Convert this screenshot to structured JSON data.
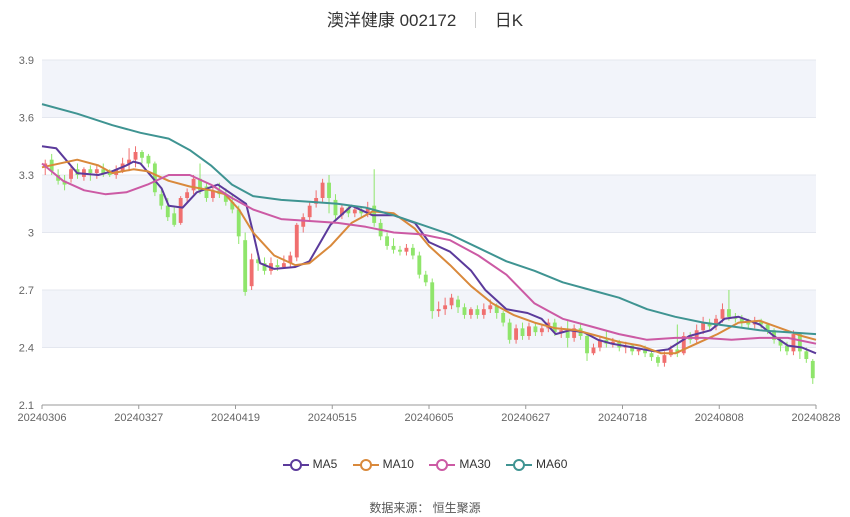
{
  "header": {
    "title": "澳洋健康 002172",
    "period": "日K"
  },
  "source": "数据来源： 恒生聚源",
  "colors": {
    "up": "#f06f6f",
    "down": "#8fe56b",
    "MA5": "#5b3a9b",
    "MA10": "#d9893b",
    "MA30": "#cc5aa4",
    "MA60": "#3f9492",
    "band": "#f2f4fa",
    "grid": "#e4e7ef"
  },
  "chart_data": {
    "type": "candlestick",
    "x_tick_labels": [
      "20240306",
      "20240327",
      "20240419",
      "20240515",
      "20240605",
      "20240627",
      "20240718",
      "20240808",
      "20240828"
    ],
    "y_ticks": [
      2.1,
      2.4,
      2.7,
      3,
      3.3,
      3.6,
      3.9
    ],
    "y_tick_labels": [
      "2.1",
      "2.4",
      "2.7",
      "3",
      "3.3",
      "3.6",
      "3.9"
    ],
    "ylim": [
      2.1,
      3.9
    ],
    "grid": true,
    "legend_position": "bottom",
    "legend": [
      "MA5",
      "MA10",
      "MA30",
      "MA60"
    ],
    "ohlc": [
      [
        3.34,
        3.36,
        3.3,
        3.38
      ],
      [
        3.38,
        3.32,
        3.3,
        3.41
      ],
      [
        3.3,
        3.27,
        3.25,
        3.33
      ],
      [
        3.27,
        3.25,
        3.22,
        3.3
      ],
      [
        3.28,
        3.33,
        3.26,
        3.35
      ],
      [
        3.33,
        3.3,
        3.28,
        3.36
      ],
      [
        3.29,
        3.33,
        3.27,
        3.34
      ],
      [
        3.33,
        3.31,
        3.27,
        3.35
      ],
      [
        3.31,
        3.33,
        3.28,
        3.35
      ],
      [
        3.33,
        3.31,
        3.29,
        3.36
      ],
      [
        3.32,
        3.3,
        3.29,
        3.33
      ],
      [
        3.3,
        3.33,
        3.28,
        3.35
      ],
      [
        3.32,
        3.36,
        3.31,
        3.39
      ],
      [
        3.36,
        3.38,
        3.32,
        3.44
      ],
      [
        3.38,
        3.42,
        3.34,
        3.45
      ],
      [
        3.42,
        3.39,
        3.36,
        3.43
      ],
      [
        3.4,
        3.36,
        3.34,
        3.41
      ],
      [
        3.36,
        3.21,
        3.19,
        3.37
      ],
      [
        3.2,
        3.14,
        3.12,
        3.22
      ],
      [
        3.14,
        3.08,
        3.06,
        3.18
      ],
      [
        3.1,
        3.04,
        3.03,
        3.13
      ],
      [
        3.05,
        3.18,
        3.04,
        3.19
      ],
      [
        3.18,
        3.21,
        3.16,
        3.23
      ],
      [
        3.22,
        3.28,
        3.2,
        3.3
      ],
      [
        3.28,
        3.22,
        3.2,
        3.36
      ],
      [
        3.24,
        3.18,
        3.16,
        3.26
      ],
      [
        3.18,
        3.22,
        3.16,
        3.25
      ],
      [
        3.22,
        3.2,
        3.18,
        3.26
      ],
      [
        3.2,
        3.16,
        3.14,
        3.23
      ],
      [
        3.16,
        3.12,
        3.1,
        3.2
      ],
      [
        3.12,
        2.98,
        2.94,
        3.14
      ],
      [
        2.96,
        2.69,
        2.67,
        3.0
      ],
      [
        2.72,
        2.86,
        2.7,
        2.89
      ],
      [
        2.86,
        2.84,
        2.8,
        2.88
      ],
      [
        2.84,
        2.8,
        2.78,
        2.87
      ],
      [
        2.8,
        2.84,
        2.78,
        2.87
      ],
      [
        2.83,
        2.82,
        2.8,
        2.86
      ],
      [
        2.82,
        2.84,
        2.81,
        2.88
      ],
      [
        2.84,
        2.88,
        2.82,
        2.9
      ],
      [
        2.87,
        3.04,
        2.85,
        3.05
      ],
      [
        3.03,
        3.08,
        3.0,
        3.1
      ],
      [
        3.08,
        3.14,
        3.06,
        3.16
      ],
      [
        3.15,
        3.18,
        3.13,
        3.22
      ],
      [
        3.18,
        3.26,
        3.16,
        3.28
      ],
      [
        3.26,
        3.18,
        3.1,
        3.3
      ],
      [
        3.17,
        3.09,
        3.07,
        3.2
      ],
      [
        3.09,
        3.13,
        3.07,
        3.15
      ],
      [
        3.13,
        3.1,
        3.08,
        3.14
      ],
      [
        3.1,
        3.12,
        3.08,
        3.14
      ],
      [
        3.12,
        3.1,
        3.08,
        3.13
      ],
      [
        3.1,
        3.13,
        3.08,
        3.16
      ],
      [
        3.14,
        3.05,
        3.03,
        3.33
      ],
      [
        3.05,
        2.98,
        2.96,
        3.07
      ],
      [
        2.98,
        2.93,
        2.91,
        3.0
      ],
      [
        2.93,
        2.91,
        2.89,
        2.97
      ],
      [
        2.91,
        2.9,
        2.88,
        2.93
      ],
      [
        2.9,
        2.92,
        2.88,
        2.94
      ],
      [
        2.92,
        2.88,
        2.86,
        2.94
      ],
      [
        2.88,
        2.78,
        2.76,
        2.9
      ],
      [
        2.78,
        2.74,
        2.72,
        2.8
      ],
      [
        2.74,
        2.59,
        2.55,
        2.76
      ],
      [
        2.59,
        2.6,
        2.56,
        2.64
      ],
      [
        2.6,
        2.62,
        2.57,
        2.66
      ],
      [
        2.62,
        2.66,
        2.6,
        2.68
      ],
      [
        2.65,
        2.61,
        2.58,
        2.67
      ],
      [
        2.61,
        2.57,
        2.55,
        2.63
      ],
      [
        2.57,
        2.6,
        2.55,
        2.61
      ],
      [
        2.6,
        2.57,
        2.55,
        2.62
      ],
      [
        2.57,
        2.6,
        2.55,
        2.63
      ],
      [
        2.6,
        2.62,
        2.58,
        2.65
      ],
      [
        2.62,
        2.58,
        2.55,
        2.63
      ],
      [
        2.58,
        2.53,
        2.51,
        2.59
      ],
      [
        2.53,
        2.44,
        2.42,
        2.55
      ],
      [
        2.44,
        2.5,
        2.42,
        2.52
      ],
      [
        2.5,
        2.46,
        2.44,
        2.53
      ],
      [
        2.46,
        2.51,
        2.44,
        2.53
      ],
      [
        2.51,
        2.48,
        2.46,
        2.53
      ],
      [
        2.48,
        2.5,
        2.46,
        2.52
      ],
      [
        2.5,
        2.53,
        2.48,
        2.55
      ],
      [
        2.53,
        2.48,
        2.46,
        2.55
      ],
      [
        2.48,
        2.49,
        2.45,
        2.51
      ],
      [
        2.49,
        2.45,
        2.4,
        2.54
      ],
      [
        2.45,
        2.5,
        2.43,
        2.52
      ],
      [
        2.5,
        2.46,
        2.44,
        2.53
      ],
      [
        2.46,
        2.37,
        2.33,
        2.48
      ],
      [
        2.37,
        2.4,
        2.36,
        2.42
      ],
      [
        2.4,
        2.44,
        2.38,
        2.46
      ],
      [
        2.44,
        2.42,
        2.4,
        2.49
      ],
      [
        2.42,
        2.43,
        2.4,
        2.45
      ],
      [
        2.43,
        2.4,
        2.38,
        2.44
      ],
      [
        2.4,
        2.41,
        2.37,
        2.43
      ],
      [
        2.41,
        2.38,
        2.36,
        2.42
      ],
      [
        2.38,
        2.39,
        2.36,
        2.4
      ],
      [
        2.39,
        2.37,
        2.35,
        2.41
      ],
      [
        2.37,
        2.35,
        2.33,
        2.38
      ],
      [
        2.35,
        2.32,
        2.3,
        2.36
      ],
      [
        2.32,
        2.36,
        2.3,
        2.38
      ],
      [
        2.36,
        2.39,
        2.35,
        2.41
      ],
      [
        2.39,
        2.37,
        2.35,
        2.52
      ],
      [
        2.37,
        2.46,
        2.36,
        2.48
      ],
      [
        2.46,
        2.44,
        2.42,
        2.48
      ],
      [
        2.44,
        2.49,
        2.42,
        2.52
      ],
      [
        2.49,
        2.53,
        2.47,
        2.56
      ],
      [
        2.53,
        2.51,
        2.49,
        2.55
      ],
      [
        2.51,
        2.55,
        2.49,
        2.57
      ],
      [
        2.55,
        2.6,
        2.53,
        2.63
      ],
      [
        2.6,
        2.56,
        2.54,
        2.7
      ],
      [
        2.56,
        2.55,
        2.53,
        2.58
      ],
      [
        2.55,
        2.53,
        2.5,
        2.57
      ],
      [
        2.53,
        2.52,
        2.5,
        2.55
      ],
      [
        2.52,
        2.54,
        2.5,
        2.56
      ],
      [
        2.54,
        2.52,
        2.5,
        2.55
      ],
      [
        2.52,
        2.49,
        2.47,
        2.53
      ],
      [
        2.49,
        2.44,
        2.42,
        2.5
      ],
      [
        2.44,
        2.41,
        2.38,
        2.45
      ],
      [
        2.41,
        2.38,
        2.36,
        2.43
      ],
      [
        2.38,
        2.47,
        2.36,
        2.49
      ],
      [
        2.47,
        2.38,
        2.34,
        2.48
      ],
      [
        2.38,
        2.34,
        2.32,
        2.4
      ],
      [
        2.33,
        2.24,
        2.21,
        2.34
      ]
    ],
    "series": [
      {
        "name": "MA5",
        "values": [
          [
            0,
            3.45
          ],
          [
            0.02,
            3.44
          ],
          [
            0.05,
            3.31
          ],
          [
            0.08,
            3.3
          ],
          [
            0.1,
            3.32
          ],
          [
            0.12,
            3.35
          ],
          [
            0.13,
            3.37
          ],
          [
            0.14,
            3.36
          ],
          [
            0.17,
            3.23
          ],
          [
            0.18,
            3.14
          ],
          [
            0.2,
            3.13
          ],
          [
            0.22,
            3.21
          ],
          [
            0.25,
            3.25
          ],
          [
            0.27,
            3.2
          ],
          [
            0.29,
            3.15
          ],
          [
            0.3,
            3.0
          ],
          [
            0.31,
            2.84
          ],
          [
            0.33,
            2.81
          ],
          [
            0.36,
            2.82
          ],
          [
            0.38,
            2.85
          ],
          [
            0.41,
            3.04
          ],
          [
            0.44,
            3.14
          ],
          [
            0.47,
            3.09
          ],
          [
            0.5,
            3.09
          ],
          [
            0.53,
            3.05
          ],
          [
            0.55,
            2.95
          ],
          [
            0.58,
            2.9
          ],
          [
            0.61,
            2.8
          ],
          [
            0.63,
            2.7
          ],
          [
            0.66,
            2.6
          ],
          [
            0.69,
            2.58
          ],
          [
            0.71,
            2.55
          ],
          [
            0.73,
            2.47
          ],
          [
            0.75,
            2.49
          ],
          [
            0.77,
            2.48
          ],
          [
            0.79,
            2.44
          ],
          [
            0.81,
            2.42
          ],
          [
            0.84,
            2.4
          ],
          [
            0.87,
            2.38
          ],
          [
            0.89,
            2.39
          ],
          [
            0.92,
            2.46
          ],
          [
            0.95,
            2.49
          ],
          [
            0.97,
            2.55
          ],
          [
            0.99,
            2.56
          ],
          [
            1.02,
            2.52
          ],
          [
            1.04,
            2.46
          ],
          [
            1.06,
            2.41
          ],
          [
            1.08,
            2.4
          ],
          [
            1.1,
            2.37
          ]
        ]
      },
      {
        "name": "MA10",
        "values": [
          [
            0,
            3.34
          ],
          [
            0.05,
            3.38
          ],
          [
            0.08,
            3.35
          ],
          [
            0.1,
            3.31
          ],
          [
            0.13,
            3.33
          ],
          [
            0.15,
            3.32
          ],
          [
            0.18,
            3.27
          ],
          [
            0.21,
            3.24
          ],
          [
            0.24,
            3.22
          ],
          [
            0.26,
            3.2
          ],
          [
            0.28,
            3.12
          ],
          [
            0.3,
            3.0
          ],
          [
            0.33,
            2.88
          ],
          [
            0.36,
            2.83
          ],
          [
            0.38,
            2.84
          ],
          [
            0.41,
            2.93
          ],
          [
            0.44,
            3.05
          ],
          [
            0.47,
            3.11
          ],
          [
            0.5,
            3.1
          ],
          [
            0.53,
            3.02
          ],
          [
            0.55,
            2.93
          ],
          [
            0.58,
            2.83
          ],
          [
            0.61,
            2.72
          ],
          [
            0.64,
            2.63
          ],
          [
            0.67,
            2.57
          ],
          [
            0.7,
            2.53
          ],
          [
            0.73,
            2.5
          ],
          [
            0.76,
            2.49
          ],
          [
            0.79,
            2.46
          ],
          [
            0.82,
            2.43
          ],
          [
            0.85,
            2.41
          ],
          [
            0.88,
            2.37
          ],
          [
            0.9,
            2.37
          ],
          [
            0.93,
            2.42
          ],
          [
            0.96,
            2.47
          ],
          [
            0.99,
            2.53
          ],
          [
            1.02,
            2.54
          ],
          [
            1.05,
            2.5
          ],
          [
            1.08,
            2.46
          ],
          [
            1.1,
            2.44
          ]
        ]
      },
      {
        "name": "MA30",
        "values": [
          [
            0,
            3.36
          ],
          [
            0.03,
            3.27
          ],
          [
            0.06,
            3.22
          ],
          [
            0.09,
            3.2
          ],
          [
            0.12,
            3.21
          ],
          [
            0.15,
            3.25
          ],
          [
            0.18,
            3.3
          ],
          [
            0.21,
            3.3
          ],
          [
            0.24,
            3.25
          ],
          [
            0.27,
            3.18
          ],
          [
            0.3,
            3.12
          ],
          [
            0.34,
            3.07
          ],
          [
            0.38,
            3.06
          ],
          [
            0.42,
            3.05
          ],
          [
            0.46,
            3.03
          ],
          [
            0.5,
            3.0
          ],
          [
            0.54,
            2.99
          ],
          [
            0.58,
            2.96
          ],
          [
            0.62,
            2.88
          ],
          [
            0.66,
            2.78
          ],
          [
            0.7,
            2.63
          ],
          [
            0.74,
            2.55
          ],
          [
            0.78,
            2.51
          ],
          [
            0.82,
            2.47
          ],
          [
            0.86,
            2.44
          ],
          [
            0.9,
            2.45
          ],
          [
            0.94,
            2.45
          ],
          [
            0.98,
            2.44
          ],
          [
            1.02,
            2.45
          ],
          [
            1.06,
            2.45
          ],
          [
            1.1,
            2.42
          ]
        ]
      },
      {
        "name": "MA60",
        "values": [
          [
            0,
            3.67
          ],
          [
            0.05,
            3.62
          ],
          [
            0.1,
            3.56
          ],
          [
            0.14,
            3.52
          ],
          [
            0.18,
            3.49
          ],
          [
            0.21,
            3.43
          ],
          [
            0.24,
            3.35
          ],
          [
            0.27,
            3.25
          ],
          [
            0.3,
            3.19
          ],
          [
            0.34,
            3.17
          ],
          [
            0.38,
            3.16
          ],
          [
            0.42,
            3.15
          ],
          [
            0.46,
            3.13
          ],
          [
            0.5,
            3.09
          ],
          [
            0.54,
            3.04
          ],
          [
            0.58,
            2.99
          ],
          [
            0.62,
            2.92
          ],
          [
            0.66,
            2.85
          ],
          [
            0.7,
            2.8
          ],
          [
            0.74,
            2.74
          ],
          [
            0.78,
            2.7
          ],
          [
            0.82,
            2.66
          ],
          [
            0.86,
            2.6
          ],
          [
            0.9,
            2.56
          ],
          [
            0.94,
            2.53
          ],
          [
            0.98,
            2.51
          ],
          [
            1.02,
            2.49
          ],
          [
            1.06,
            2.48
          ],
          [
            1.1,
            2.47
          ]
        ]
      }
    ]
  }
}
